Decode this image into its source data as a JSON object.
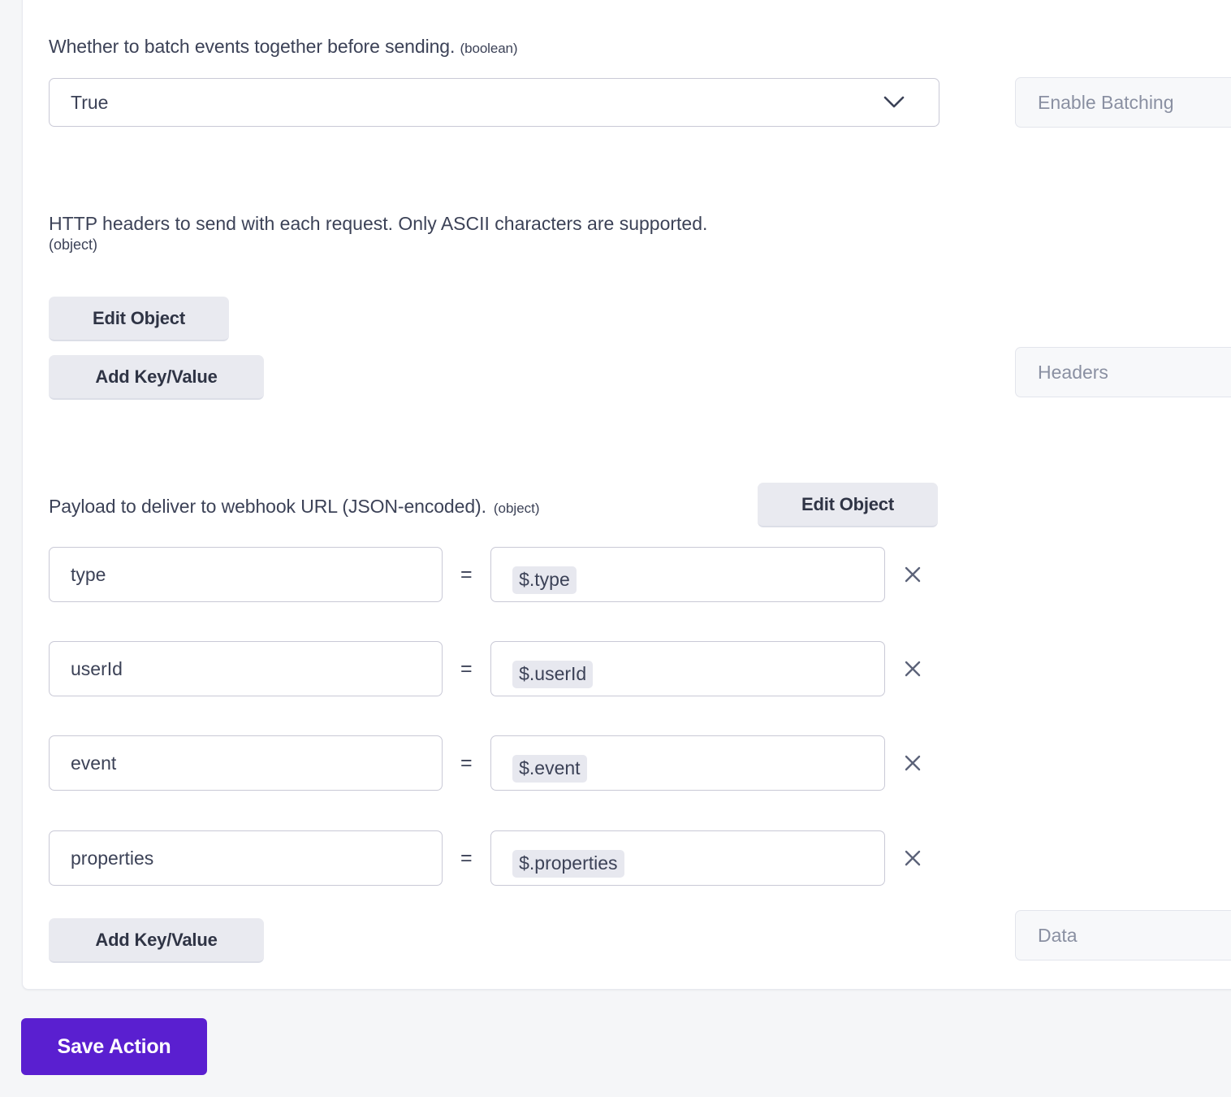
{
  "batching": {
    "label": "Whether to batch events together before sending.",
    "type_tag": "(boolean)",
    "value": "True",
    "chevron_icon": "chevron-down-icon",
    "field_name_readonly": "Enable Batching"
  },
  "headers": {
    "label": "HTTP headers to send with each request. Only ASCII characters are supported.",
    "type_tag": "(object)",
    "edit_object_label": "Edit Object",
    "add_key_value_label": "Add Key/Value",
    "field_name_readonly": "Headers"
  },
  "payload": {
    "label": "Payload to deliver to webhook URL (JSON-encoded).",
    "type_tag": "(object)",
    "edit_object_label": "Edit Object",
    "add_key_value_label": "Add Key/Value",
    "field_name_readonly": "Data",
    "equals_sign": "=",
    "delete_icon": "close-icon",
    "rows": [
      {
        "key": "type",
        "value": "$.type"
      },
      {
        "key": "userId",
        "value": "$.userId"
      },
      {
        "key": "event",
        "value": "$.event"
      },
      {
        "key": "properties",
        "value": "$.properties"
      }
    ]
  },
  "footer": {
    "save_label": "Save Action"
  },
  "colors": {
    "accent": "#5a1fd0",
    "page_bg": "#f5f6f8",
    "card_bg": "#ffffff",
    "input_border": "#c9c9d6",
    "button_gray": "#e9eaf0",
    "token_bg": "#e7e8ef",
    "muted_text": "#8a90a2"
  }
}
